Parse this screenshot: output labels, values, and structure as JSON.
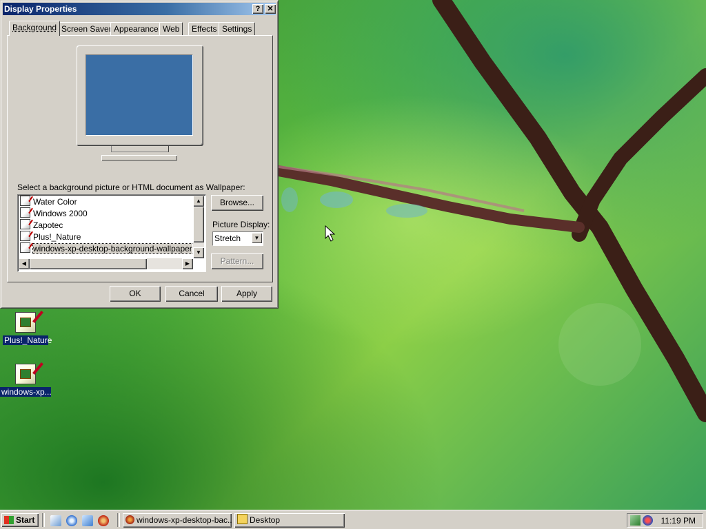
{
  "window": {
    "title": "Display Properties",
    "help_button": "?",
    "close_button": "✕"
  },
  "tabs": [
    {
      "label": "Background",
      "active": true
    },
    {
      "label": "Screen Saver",
      "active": false
    },
    {
      "label": "Appearance",
      "active": false
    },
    {
      "label": "Web",
      "active": false
    },
    {
      "label": "Effects",
      "active": false
    },
    {
      "label": "Settings",
      "active": false
    }
  ],
  "background_tab": {
    "wallpaper_prompt": "Select a background picture or HTML document as Wallpaper:",
    "wallpapers": [
      {
        "name": "Water Color",
        "selected": false
      },
      {
        "name": "Windows 2000",
        "selected": false
      },
      {
        "name": "Zapotec",
        "selected": false
      },
      {
        "name": "Plus!_Nature",
        "selected": false
      },
      {
        "name": "windows-xp-desktop-background-wallpaper-autur",
        "selected": true
      }
    ],
    "browse_label": "Browse...",
    "picture_display_label": "Picture Display:",
    "picture_display_value": "Stretch",
    "pattern_label": "Pattern...",
    "preview_color": "#3a6ea5"
  },
  "footer": {
    "ok_label": "OK",
    "cancel_label": "Cancel",
    "apply_label": "Apply"
  },
  "desktop_icons": [
    {
      "label": "Plus!_Nature",
      "icon": "wallpaper-file-icon"
    },
    {
      "label": "windows-xp...",
      "icon": "wallpaper-file-icon"
    }
  ],
  "taskbar": {
    "start_label": "Start",
    "quick_launch": [
      "show-desktop-icon",
      "internet-explorer-icon",
      "outlook-express-icon",
      "media-player-icon"
    ],
    "tasks": [
      {
        "label": "windows-xp-desktop-bac...",
        "icon": "image-viewer-icon"
      },
      {
        "label": "Desktop",
        "icon": "folder-icon"
      }
    ],
    "clock": "11:19 PM"
  },
  "colors": {
    "title_active_start": "#0a246a",
    "title_active_end": "#a6caf0",
    "face": "#d4d0c8"
  }
}
